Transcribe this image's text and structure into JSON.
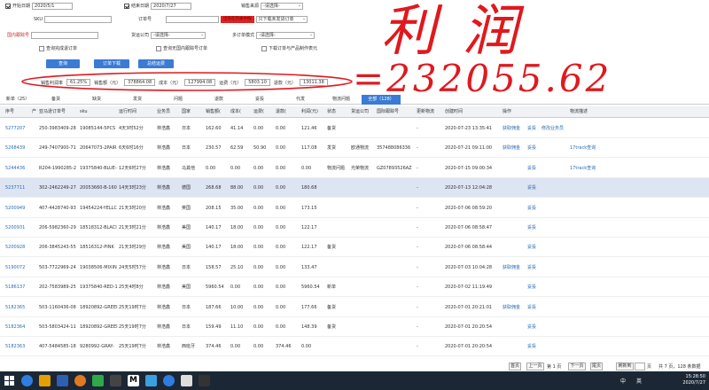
{
  "filters": {
    "start_date_label": "开始日期",
    "start_date_value": "2020/5/1",
    "end_date_label": "结束日期",
    "end_date_value": "2020/7/27",
    "sales_source_label": "销售来源",
    "sales_source_value": "-请选择-",
    "sku_label": "SKU",
    "order_no_label": "订单号",
    "order_red_text": "出现在列表中按",
    "order_tail_value": "只下载未发货订单",
    "platform_order_label": "国内跟踪号",
    "freight_label": "货运公司",
    "freight_value": "-请选择-",
    "multi_order_label": "多订单模式",
    "multi_order_value": "-请选择-",
    "check_done_label": "查询完成退订单",
    "check_transit_label": "查询无国内跟踪号订单",
    "check_download_label": "下载订单与产品制作表元"
  },
  "buttons": {
    "query": "查询",
    "order_download": "订单下载",
    "stats_summary": "总结运费"
  },
  "stats": {
    "margin_label": "销售利润率",
    "margin_value": "61.25%",
    "sales_label": "销售额（元）",
    "sales_value": "378864.08",
    "cost_label": "成本（元）",
    "cost_value": "127994.08",
    "freight_label": "运费（元）",
    "freight_value": "5803.10",
    "refund_label": "退款（元）",
    "refund_value": "13011.38"
  },
  "handwriting": {
    "title": "利润",
    "equation": "=232055.62"
  },
  "tabs": [
    {
      "label": "新单（25）"
    },
    {
      "label": "备货"
    },
    {
      "label": "缺货"
    },
    {
      "label": "发货"
    },
    {
      "label": "问题"
    },
    {
      "label": "退款"
    },
    {
      "label": "妥投"
    },
    {
      "label": "代发"
    },
    {
      "label": "物流问题"
    },
    {
      "label": "全部（128）"
    }
  ],
  "table": {
    "headers": [
      "序号",
      "产",
      "亚马逊订单号",
      "sku",
      "运行时间",
      "业务员",
      "国家",
      "销售额(",
      "成本(",
      "运费(",
      "退款(",
      "利润(元)",
      "状态",
      "货运公司",
      "国际跟踪号",
      "更新物流",
      "创建时间",
      "操作",
      "物流描述"
    ],
    "rows": [
      {
        "id": "5277207",
        "order": "250-3983409-28",
        "sku": "19085144-5PCS",
        "time": "4天3时52分",
        "staff": "林浩鑫",
        "country": "日本",
        "sales": "162.60",
        "cost": "41.14",
        "freight": "0.00",
        "refund": "0.00",
        "profit": "121.46",
        "status": "备货",
        "carrier": "",
        "tracking": "",
        "upd": "-",
        "created": "2020-07-23 13:35:41",
        "op1": "获取佣金",
        "op2": "妥投",
        "op3": "修改业务员",
        "desc": ""
      },
      {
        "id": "5268439",
        "order": "249-7407900-71",
        "sku": "20647073-2PAIR",
        "time": "6天6时16分",
        "staff": "林浩鑫",
        "country": "日本",
        "sales": "230.57",
        "cost": "62.59",
        "freight": "50.90",
        "refund": "0.00",
        "profit": "117.08",
        "status": "发货",
        "carrier": "欧通物流",
        "tracking": "357488086336",
        "upd": "-",
        "created": "2020-07-21 09:11:00",
        "op1": "获取佣金",
        "op2": "妥投",
        "op3": "",
        "desc": "17track查询"
      },
      {
        "id": "5244436",
        "order": "R204-1990285-2",
        "sku": "19375840-BLUE-",
        "time": "12天6时27分",
        "staff": "林浩鑫",
        "country": "马其他",
        "sales": "0.00",
        "cost": "0.00",
        "freight": "0.00",
        "refund": "0.00",
        "profit": "0.00",
        "status": "物流问题",
        "carrier": "光荣物流",
        "tracking": "GZ07893526AZ",
        "upd": "-",
        "created": "2020-07-15 09:00:34",
        "op1": "",
        "op2": "妥投",
        "op3": "",
        "desc": "17track查询"
      },
      {
        "id": "5237711",
        "order": "302-2462249-27",
        "sku": "20053660-B-160",
        "time": "14天3时23分",
        "staff": "林浩鑫",
        "country": "德国",
        "sales": "268.68",
        "cost": "88.00",
        "freight": "0.00",
        "refund": "0.00",
        "profit": "180.68",
        "status": "",
        "carrier": "",
        "tracking": "",
        "upd": "-",
        "created": "2020-07-13 12:04:28",
        "op1": "",
        "op2": "妥投",
        "op3": "",
        "desc": ""
      },
      {
        "id": "5200949",
        "order": "407-4428740-93",
        "sku": "19454224-YELLC",
        "time": "21天3时20分",
        "staff": "林浩鑫",
        "country": "英国",
        "sales": "208.15",
        "cost": "35.00",
        "freight": "0.00",
        "refund": "0.00",
        "profit": "173.15",
        "status": "",
        "carrier": "",
        "tracking": "",
        "upd": "-",
        "created": "2020-07-06 08:59:20",
        "op1": "",
        "op2": "妥投",
        "op3": "",
        "desc": ""
      },
      {
        "id": "5200931",
        "order": "206-5982360-29",
        "sku": "18518312-BLACI",
        "time": "21天3时21分",
        "staff": "林浩鑫",
        "country": "美国",
        "sales": "140.17",
        "cost": "18.00",
        "freight": "0.00",
        "refund": "0.00",
        "profit": "122.17",
        "status": "",
        "carrier": "",
        "tracking": "",
        "upd": "-",
        "created": "2020-07-06 08:58:47",
        "op1": "",
        "op2": "妥投",
        "op3": "",
        "desc": ""
      },
      {
        "id": "5200928",
        "order": "206-3845243-55",
        "sku": "18516312-PINK",
        "time": "21天3时29分",
        "staff": "林浩鑫",
        "country": "美国",
        "sales": "140.17",
        "cost": "18.00",
        "freight": "0.00",
        "refund": "0.00",
        "profit": "122.17",
        "status": "备货",
        "carrier": "",
        "tracking": "",
        "upd": "-",
        "created": "2020-07-06 08:58:44",
        "op1": "",
        "op2": "妥投",
        "op3": "",
        "desc": ""
      },
      {
        "id": "5190072",
        "order": "503-7722969-24",
        "sku": "19038506-MIXIN",
        "time": "24天5时57分",
        "staff": "林浩鑫",
        "country": "日本",
        "sales": "158.57",
        "cost": "25.10",
        "freight": "0.00",
        "refund": "0.00",
        "profit": "133.47",
        "status": "",
        "carrier": "",
        "tracking": "",
        "upd": "-",
        "created": "2020-07-03 10:04:28",
        "op1": "获取佣金",
        "op2": "妥投",
        "op3": "",
        "desc": ""
      },
      {
        "id": "5186137",
        "order": "202-7583989-25",
        "sku": "19375840-RED-1",
        "time": "25天4时8分",
        "staff": "林浩鑫",
        "country": "美国",
        "sales": "5960.54",
        "cost": "0.00",
        "freight": "0.00",
        "refund": "0.00",
        "profit": "5960.54",
        "status": "新单",
        "carrier": "",
        "tracking": "",
        "upd": "-",
        "created": "2020-07-02 11:19:49",
        "op1": "",
        "op2": "妥投",
        "op3": "",
        "desc": ""
      },
      {
        "id": "5182365",
        "order": "503-1160436-08",
        "sku": "18920892-GREEI",
        "time": "25天19时7分",
        "staff": "林浩鑫",
        "country": "日本",
        "sales": "187.66",
        "cost": "10.00",
        "freight": "0.00",
        "refund": "0.00",
        "profit": "177.66",
        "status": "备货",
        "carrier": "",
        "tracking": "",
        "upd": "-",
        "created": "2020-07-01 20:21:01",
        "op1": "获取佣金",
        "op2": "妥投",
        "op3": "",
        "desc": ""
      },
      {
        "id": "5182364",
        "order": "503-5803424-11",
        "sku": "18920892-GREEI",
        "time": "25天19时7分",
        "staff": "林浩鑫",
        "country": "日本",
        "sales": "159.49",
        "cost": "11.10",
        "freight": "0.00",
        "refund": "0.00",
        "profit": "148.39",
        "status": "备货",
        "carrier": "",
        "tracking": "",
        "upd": "-",
        "created": "2020-07-01 20:20:54",
        "op1": "",
        "op2": "妥投",
        "op3": "",
        "desc": ""
      },
      {
        "id": "5182363",
        "order": "407-5484585-18",
        "sku": "9280992-GRAY-",
        "time": "25天19时7分",
        "staff": "林浩鑫",
        "country": "西班牙",
        "sales": "374.46",
        "cost": "0.00",
        "freight": "0.00",
        "refund": "374.46",
        "profit": "0.00",
        "status": "",
        "carrier": "",
        "tracking": "",
        "upd": "-",
        "created": "2020-07-01 20:20:54",
        "op1": "",
        "op2": "妥投",
        "op3": "",
        "desc": ""
      }
    ]
  },
  "pager": {
    "first": "首页",
    "prev": "上一页",
    "page": "第 1 页",
    "next": "下一页",
    "last": "尾页",
    "refresh": "刷新到",
    "unit": "页",
    "total": "共 7 页，128 条数据"
  },
  "taskbar": {
    "time": "15:28:50",
    "date": "2020/7/27",
    "ime": "中",
    "lang": "英"
  },
  "colors": {
    "accent": "#3a7bd5",
    "link": "#2a6db6",
    "highlight_row": "#dde4f2",
    "handwriting": "#e0191e",
    "red_marker": "#e02020",
    "taskbar": "#1b2734"
  }
}
